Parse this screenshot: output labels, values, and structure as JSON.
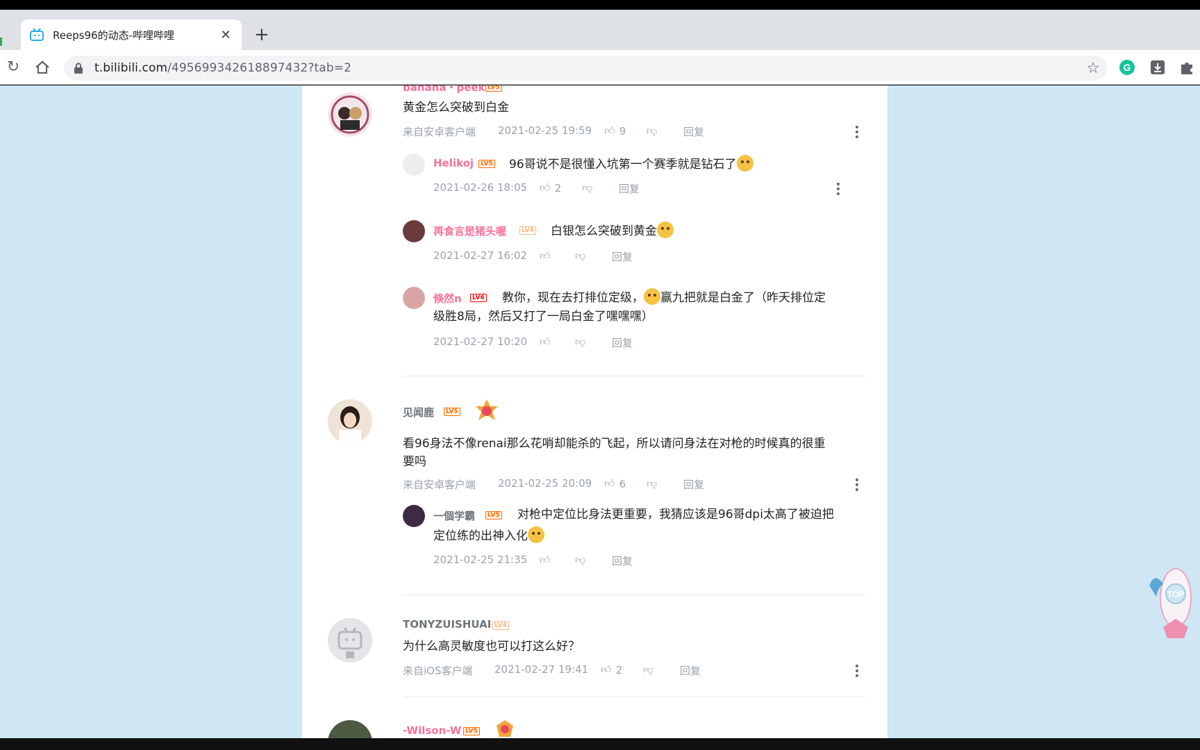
{
  "browser": {
    "tab_title": "Reeps96的动态-哔哩哔哩",
    "url_host": "t.bilibili.com",
    "url_path": "/495699342618897432?tab=2"
  },
  "comments": [
    {
      "username": "banana・peek",
      "level": "LV5",
      "text": "黄金怎么突破到白金",
      "source": "来自安卓客户端",
      "time": "2021-02-25 19:59",
      "likes": "9",
      "reply_label": "回复",
      "replies": [
        {
          "username": "Helikoj",
          "level": "LV5",
          "text": "96哥说不是很懂入坑第一个赛季就是钻石了",
          "time": "2021-02-26 18:05",
          "likes": "2",
          "reply_label": "回复"
        },
        {
          "username": "再食言是猪头喔",
          "level": "LV4",
          "text": "白银怎么突破到黄金",
          "time": "2021-02-27 16:02",
          "likes": "",
          "reply_label": "回复"
        },
        {
          "username": "倏然n",
          "level": "LV6",
          "text_a": "教你，现在去打排位定级，",
          "text_b": "赢九把就是白金了（昨天排位定",
          "text_c": "级胜8局，然后又打了一局白金了嘿嘿嘿）",
          "time": "2021-02-27 10:20",
          "likes": "",
          "reply_label": "回复"
        }
      ]
    },
    {
      "username": "见闻鹿",
      "level": "LV5",
      "text_line1": "看96身法不像renai那么花哨却能杀的飞起，所以请问身法在对枪的时候真的很重",
      "text_line2": "要吗",
      "source": "来自安卓客户端",
      "time": "2021-02-25 20:09",
      "likes": "6",
      "reply_label": "回复",
      "replies": [
        {
          "username": "一個学霸",
          "level": "LV5",
          "text_line1": "对枪中定位比身法更重要，我猜应该是96哥dpi太高了被迫把",
          "text_line2": "定位练的出神入化",
          "time": "2021-02-25 21:35",
          "likes": "",
          "reply_label": "回复"
        }
      ]
    },
    {
      "username": "TONYZUISHUAI",
      "level": "LV4",
      "text": "为什么高灵敏度也可以打这么好？",
      "source": "来自iOS客户端",
      "time": "2021-02-27 19:41",
      "likes": "2",
      "reply_label": "回复"
    },
    {
      "username": "-Wilson-W",
      "level": "LV5"
    }
  ],
  "top_button": "TOP",
  "colors": {
    "pink_name": "#fb7299",
    "page_bg": "#cfe6f4",
    "meta": "#99a2aa"
  }
}
